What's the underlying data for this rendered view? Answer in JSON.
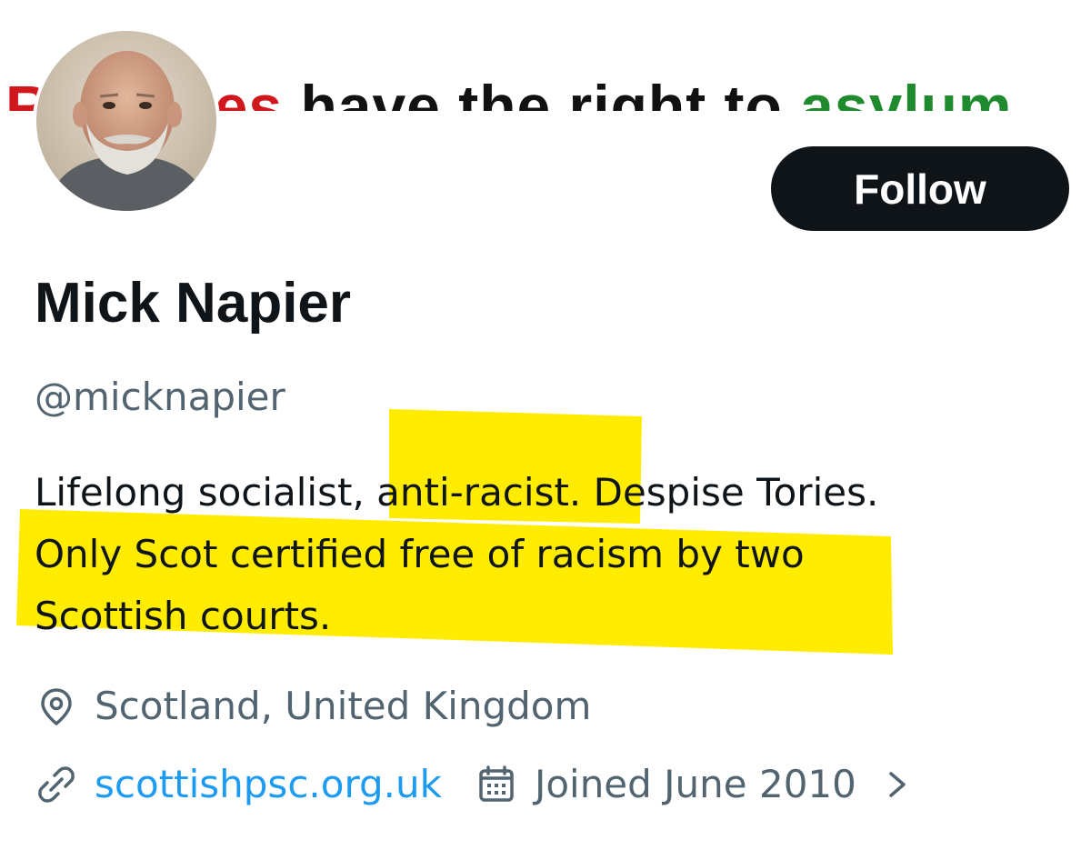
{
  "banner": {
    "text_red": "Refugees",
    "text_dark": " have the right to ",
    "text_green": "asylum"
  },
  "profile": {
    "name": "Mick Napier",
    "handle": "@micknapier",
    "follow_label": "Follow",
    "bio_lines": [
      "Lifelong socialist, anti-racist. Despise Tories.",
      "Only Scot certified free of racism by two",
      "Scottish courts."
    ],
    "location": "Scotland, United Kingdom",
    "website": "scottishpsc.org.uk",
    "joined": "Joined June 2010"
  },
  "icons": {
    "location": "map-pin-icon",
    "link": "link-icon",
    "calendar": "calendar-icon",
    "more": "chevron-right-icon"
  },
  "colors": {
    "follow_bg": "#0f1419",
    "link": "#1d9bf0",
    "secondary_text": "#536471",
    "highlight": "#ffec00",
    "banner_red": "#d0181c",
    "banner_green": "#1f8a2e"
  }
}
